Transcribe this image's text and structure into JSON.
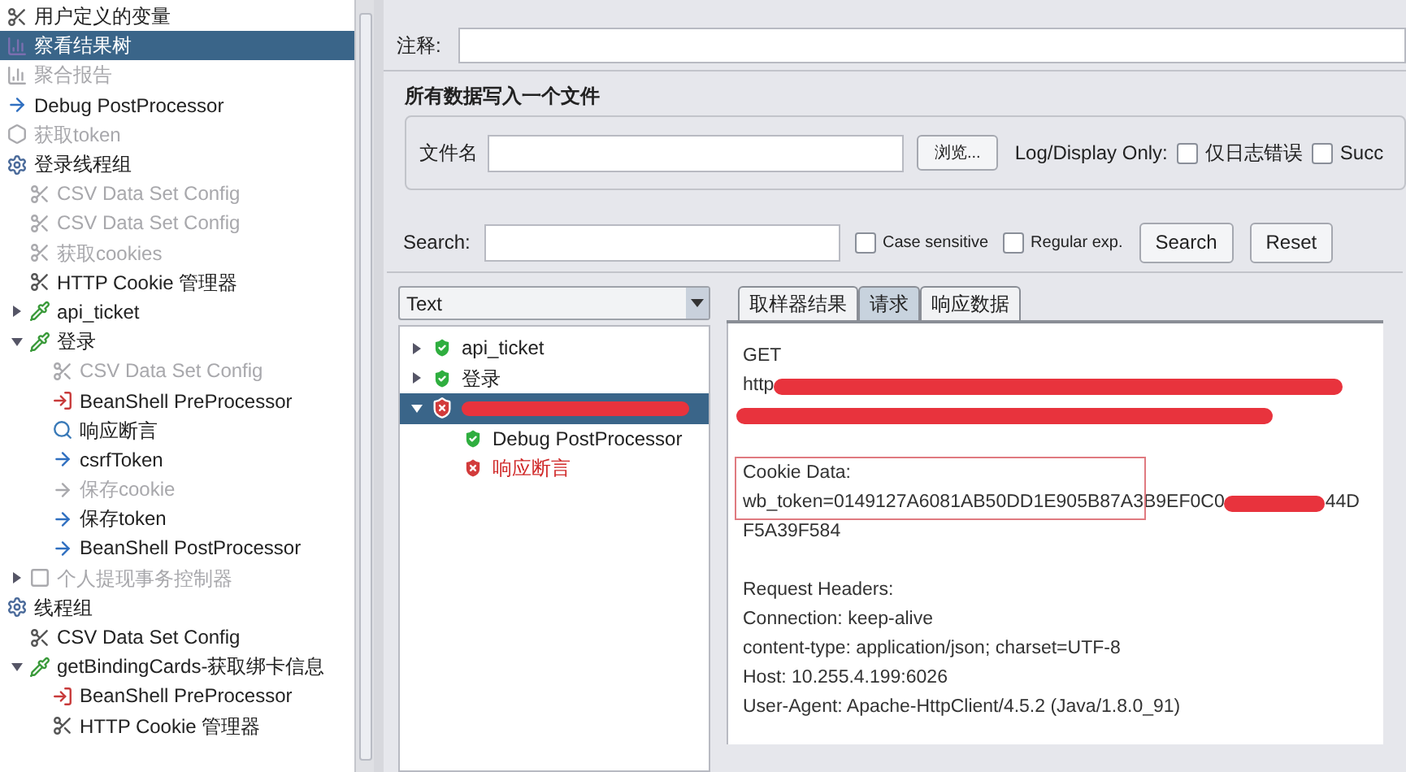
{
  "tree": [
    {
      "label": "用户定义的变量",
      "kind": "config",
      "disabled": false,
      "selected": false
    },
    {
      "label": "察看结果树",
      "kind": "listener",
      "disabled": false,
      "selected": true
    },
    {
      "label": "聚合报告",
      "kind": "listener",
      "disabled": true,
      "selected": false
    },
    {
      "label": "Debug PostProcessor",
      "kind": "postprocessor",
      "disabled": false,
      "selected": false
    },
    {
      "label": "获取token",
      "kind": "extractor",
      "disabled": true,
      "selected": false
    },
    {
      "label": "登录线程组",
      "kind": "threadgroup",
      "disabled": false,
      "selected": false,
      "children": [
        {
          "label": "CSV Data Set Config",
          "kind": "config",
          "disabled": true,
          "selected": false
        },
        {
          "label": "CSV Data Set Config",
          "kind": "config",
          "disabled": true,
          "selected": false
        },
        {
          "label": "获取cookies",
          "kind": "config",
          "disabled": true,
          "selected": false
        },
        {
          "label": "HTTP Cookie 管理器",
          "kind": "config",
          "disabled": false,
          "selected": false
        },
        {
          "label": "api_ticket",
          "kind": "sampler",
          "disabled": false,
          "selected": false,
          "expanded": false
        },
        {
          "label": "登录",
          "kind": "sampler",
          "disabled": false,
          "selected": false,
          "expanded": true,
          "children": [
            {
              "label": "CSV Data Set Config",
              "kind": "config",
              "disabled": true,
              "selected": false
            },
            {
              "label": "BeanShell PreProcessor",
              "kind": "preprocessor",
              "disabled": false,
              "selected": false
            },
            {
              "label": "响应断言",
              "kind": "assertion",
              "disabled": false,
              "selected": false
            },
            {
              "label": "csrfToken",
              "kind": "postprocessor",
              "disabled": false,
              "selected": false
            },
            {
              "label": "保存cookie",
              "kind": "postprocessor",
              "disabled": true,
              "selected": false
            },
            {
              "label": "保存token",
              "kind": "postprocessor",
              "disabled": false,
              "selected": false
            },
            {
              "label": "BeanShell PostProcessor",
              "kind": "postprocessor",
              "disabled": false,
              "selected": false
            }
          ]
        },
        {
          "label": "个人提现事务控制器",
          "kind": "controller",
          "disabled": true,
          "selected": false,
          "expanded": false
        }
      ]
    },
    {
      "label": "线程组",
      "kind": "threadgroup",
      "disabled": false,
      "selected": false,
      "children": [
        {
          "label": "CSV Data Set Config",
          "kind": "config",
          "disabled": false,
          "selected": false
        },
        {
          "label": "getBindingCards-获取绑卡信息",
          "kind": "sampler",
          "disabled": false,
          "selected": false,
          "expanded": true,
          "children": [
            {
              "label": "BeanShell PreProcessor",
              "kind": "preprocessor",
              "disabled": false,
              "selected": false
            },
            {
              "label": "HTTP Cookie 管理器",
              "kind": "config",
              "disabled": false,
              "selected": false
            }
          ]
        }
      ]
    }
  ],
  "comment": {
    "label": "注释:"
  },
  "file_section": {
    "title": "所有数据写入一个文件",
    "file_label": "文件名",
    "browse": "浏览...",
    "log_label": "Log/Display Only:",
    "options": [
      {
        "label": "仅日志错误",
        "checked": false
      },
      {
        "label": "Succ",
        "checked": false
      }
    ]
  },
  "search": {
    "label": "Search:",
    "options": [
      {
        "label": "Case sensitive",
        "checked": false
      },
      {
        "label": "Regular exp.",
        "checked": false
      }
    ],
    "buttons": [
      "Search",
      "Reset"
    ]
  },
  "renderer": {
    "value": "Text"
  },
  "results": [
    {
      "label": "api_ticket",
      "passed": true,
      "selected": false,
      "expanded": false
    },
    {
      "label": "登录",
      "passed": true,
      "selected": false,
      "expanded": false
    },
    {
      "passed": false,
      "selected": true,
      "expanded": true,
      "children": [
        {
          "label": "Debug PostProcessor",
          "passed": true,
          "selected": false
        },
        {
          "label": "响应断言",
          "passed": false,
          "selected": false
        }
      ]
    }
  ],
  "tabs": [
    {
      "label": "取样器结果",
      "selected": false
    },
    {
      "label": "请求",
      "selected": true
    },
    {
      "label": "响应数据",
      "selected": false
    }
  ],
  "request_lines": [
    {
      "kind": "text",
      "framed": false,
      "parts": [
        {
          "kind": "text",
          "text": "GET"
        }
      ]
    },
    {
      "kind": "text",
      "framed": false,
      "parts": [
        {
          "kind": "text",
          "text": "http"
        },
        {
          "kind": "redaction"
        }
      ]
    },
    {
      "kind": "text",
      "framed": false,
      "parts": [
        {
          "kind": "redaction"
        }
      ]
    },
    {
      "kind": "blank"
    },
    {
      "kind": "text",
      "framed": true,
      "parts": [
        {
          "kind": "text",
          "text": "Cookie Data:"
        }
      ]
    },
    {
      "kind": "text",
      "framed": true,
      "parts": [
        {
          "kind": "text",
          "text": "wb_token=0149127A6081AB50DD1E905B87A3B9EF0C0"
        },
        {
          "kind": "redaction"
        },
        {
          "kind": "text",
          "text": "44D"
        }
      ]
    },
    {
      "kind": "text",
      "framed": false,
      "parts": [
        {
          "kind": "text",
          "text": "F5A39F584"
        }
      ]
    },
    {
      "kind": "blank"
    },
    {
      "kind": "text",
      "framed": false,
      "parts": [
        {
          "kind": "text",
          "text": "Request Headers:"
        }
      ]
    },
    {
      "kind": "text",
      "framed": false,
      "parts": [
        {
          "kind": "text",
          "text": "Connection: keep-alive"
        }
      ]
    },
    {
      "kind": "text",
      "framed": false,
      "parts": [
        {
          "kind": "text",
          "text": "content-type: application/json; charset=UTF-8"
        }
      ]
    },
    {
      "kind": "text",
      "framed": false,
      "parts": [
        {
          "kind": "text",
          "text": "Host: 10.255.4.199:6026"
        }
      ]
    },
    {
      "kind": "text",
      "framed": false,
      "parts": [
        {
          "kind": "text",
          "text": "User-Agent: Apache-HttpClient/4.5.2 (Java/1.8.0_91)"
        }
      ]
    }
  ]
}
